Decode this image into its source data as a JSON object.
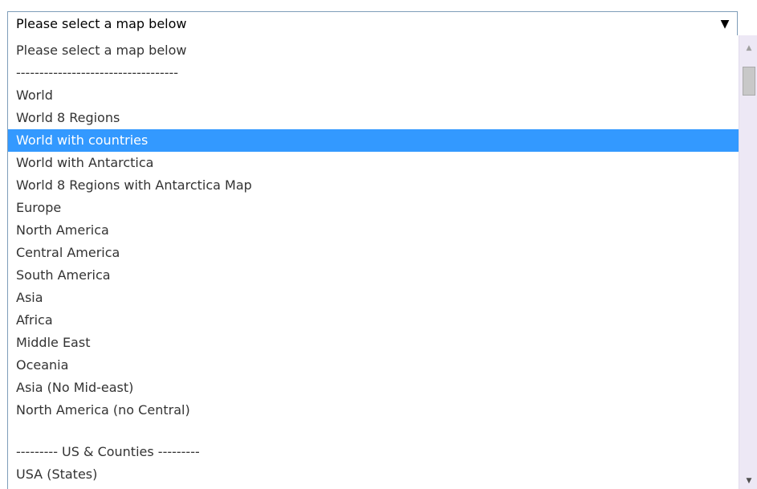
{
  "select": {
    "selected_value": "Please select a map below",
    "arrow_icon": "▼"
  },
  "dropdown": {
    "options": [
      "Please select a map below",
      "-----------------------------------",
      "World",
      "World 8 Regions",
      "World with countries",
      "World with Antarctica",
      "World 8 Regions with Antarctica Map",
      "Europe",
      "North America",
      "Central America",
      "South America",
      "Asia",
      "Africa",
      "Middle East",
      "Oceania",
      "Asia (No Mid-east)",
      "North America (no Central)",
      "",
      "--------- US & Counties ---------",
      "USA (States)"
    ],
    "highlighted_option": "World with countries"
  },
  "scrollbar": {
    "up_icon": "▲",
    "down_icon": "▼"
  },
  "colors": {
    "highlight": "#3399ff",
    "highlight_text": "#ffffff",
    "option_text": "#333333",
    "border": "#7f9db9",
    "scrollbar_track": "#ede8f5"
  }
}
